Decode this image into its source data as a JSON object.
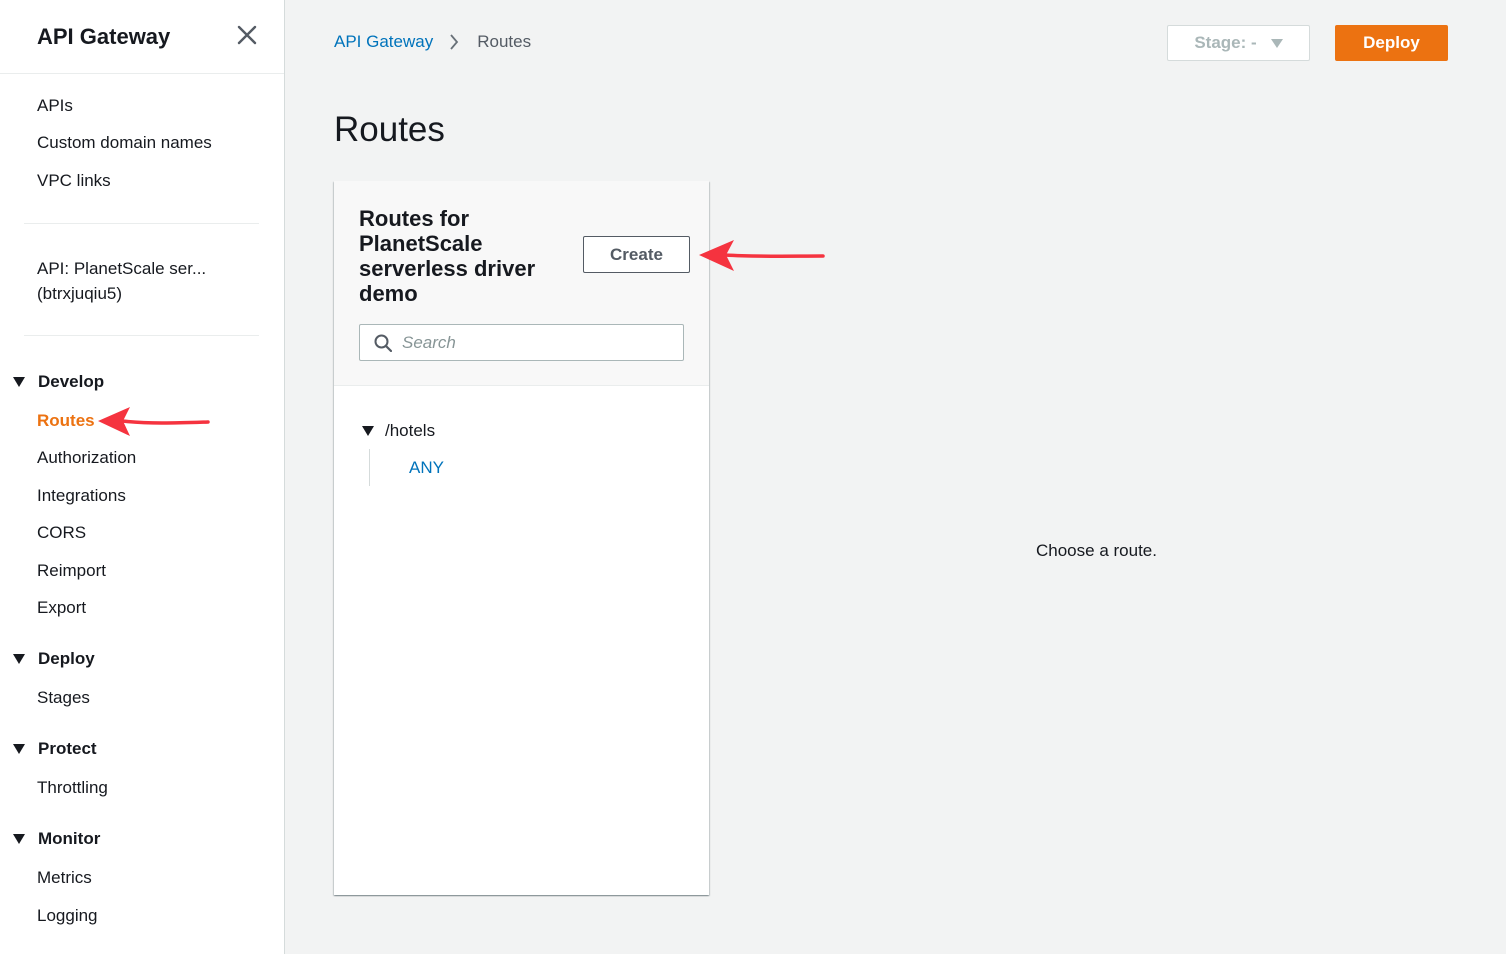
{
  "sidebar": {
    "title": "API Gateway",
    "close_icon": "close-icon",
    "top_links": [
      {
        "label": "APIs"
      },
      {
        "label": "Custom domain names"
      },
      {
        "label": "VPC links"
      }
    ],
    "api_name_line1": "API: PlanetScale ser...",
    "api_name_line2": "(btrxjuqiu5)",
    "sections": [
      {
        "label": "Develop",
        "items": [
          "Routes",
          "Authorization",
          "Integrations",
          "CORS",
          "Reimport",
          "Export"
        ]
      },
      {
        "label": "Deploy",
        "items": [
          "Stages"
        ]
      },
      {
        "label": "Protect",
        "items": [
          "Throttling"
        ]
      },
      {
        "label": "Monitor",
        "items": [
          "Metrics",
          "Logging"
        ]
      }
    ],
    "active_item": "Routes"
  },
  "breadcrumb": {
    "root": "API Gateway",
    "current": "Routes"
  },
  "toolbar": {
    "stage_label": "Stage: -",
    "deploy_label": "Deploy"
  },
  "page": {
    "title": "Routes",
    "empty_message": "Choose a route."
  },
  "routes_panel": {
    "title": "Routes for PlanetScale serverless driver demo",
    "create_label": "Create",
    "search_placeholder": "Search",
    "tree": [
      {
        "path": "/hotels",
        "methods": [
          "ANY"
        ]
      }
    ]
  },
  "colors": {
    "accent": "#ec7211",
    "link": "#0073bb",
    "annotation_arrow": "#f5333f"
  }
}
